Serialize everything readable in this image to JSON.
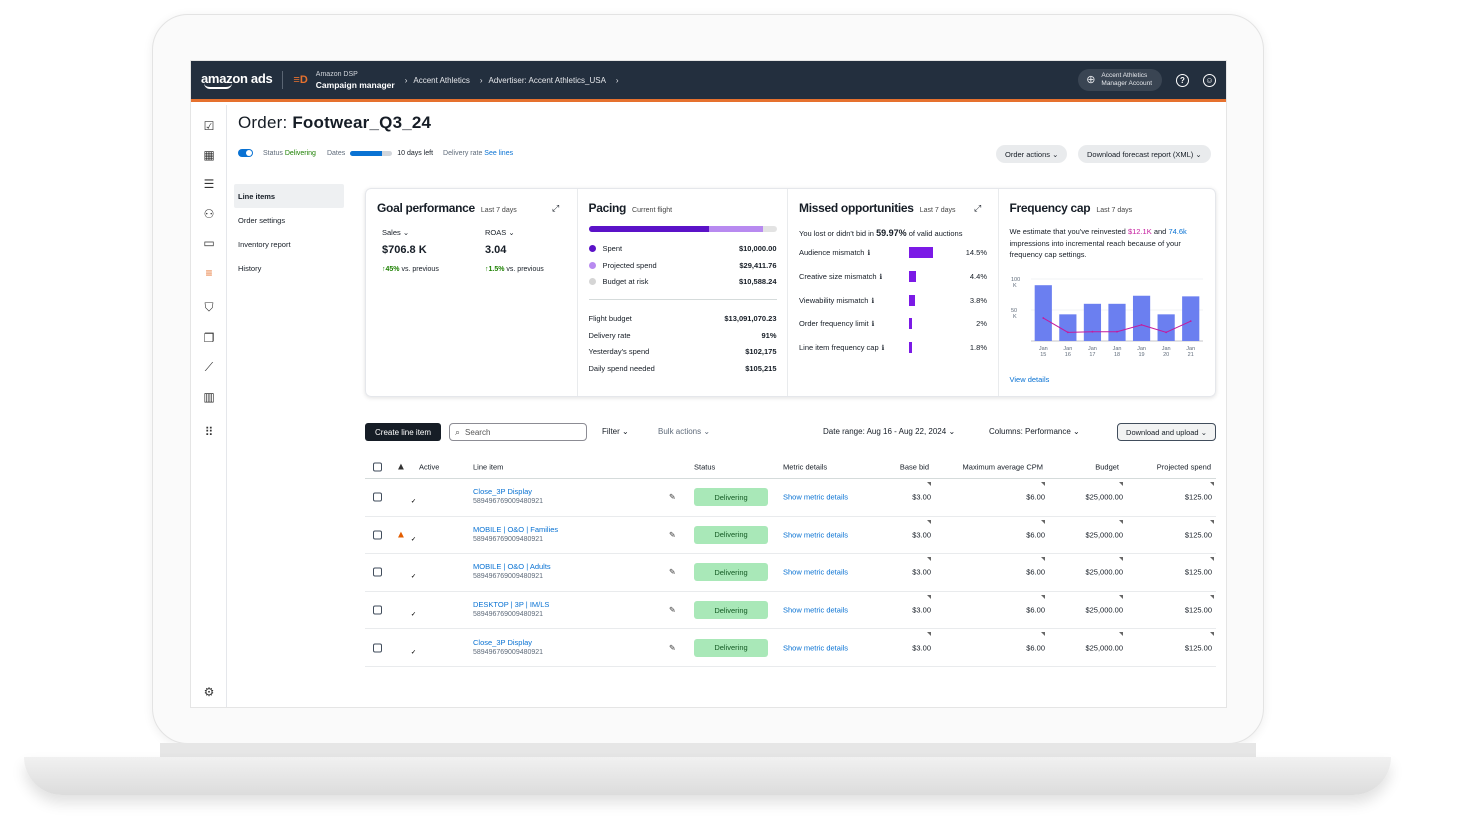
{
  "app": {
    "logo": "amazon ads",
    "product_icon": "≡D",
    "product_sub": "Amazon DSP",
    "product_name": "Campaign manager",
    "breadcrumb": [
      "Accent Athletics",
      "Advertiser: Accent Athletics_USA"
    ],
    "account_name": "Accent Athletics",
    "account_type": "Manager Account",
    "accent_color": "#e6712e"
  },
  "page": {
    "title_prefix": "Order:",
    "title": "Footwear_Q3_24",
    "status_label": "Status",
    "status_value": "Delivering",
    "dates_label": "Dates",
    "dates_progress": 0.75,
    "days_left": "10 days left",
    "delivery_rate_label": "Delivery rate",
    "delivery_rate_link": "See lines",
    "order_actions": "Order actions",
    "download_forecast": "Download forecast report (XML)"
  },
  "subnav": [
    "Line items",
    "Order settings",
    "Inventory report",
    "History"
  ],
  "goal": {
    "title": "Goal performance",
    "period": "Last 7 days",
    "metric1_label": "Sales",
    "metric1_value": "$706.8 K",
    "metric1_change": "45%",
    "metric1_change_note": "vs. previous",
    "metric2_label": "ROAS",
    "metric2_value": "3.04",
    "metric2_change": "1.5%",
    "metric2_change_note": "vs. previous"
  },
  "pacing": {
    "title": "Pacing",
    "period": "Current flight",
    "spent_fraction": 0.64,
    "projected_fraction": 0.93,
    "legend": [
      {
        "label": "Spent",
        "value": "$10,000.00",
        "color": "#5b12c8"
      },
      {
        "label": "Projected spend",
        "value": "$29,411.76",
        "color": "#b88af0"
      },
      {
        "label": "Budget at risk",
        "value": "$10,588.24",
        "color": "#d5d5d5"
      }
    ],
    "stats": [
      {
        "label": "Flight budget",
        "value": "$13,091,070.23"
      },
      {
        "label": "Delivery rate",
        "value": "91%"
      },
      {
        "label": "Yesterday's spend",
        "value": "$102,175"
      },
      {
        "label": "Daily spend needed",
        "value": "$105,215"
      }
    ]
  },
  "missed": {
    "title": "Missed opportunities",
    "period": "Last 7 days",
    "intro_before": "You lost or didn't bid in",
    "intro_pct": "59.97%",
    "intro_after": "of valid auctions",
    "rows": [
      {
        "label": "Audience mismatch",
        "value": "14.5%",
        "pct": 14.5
      },
      {
        "label": "Creative size mismatch",
        "value": "4.4%",
        "pct": 4.4
      },
      {
        "label": "Viewability mismatch",
        "value": "3.8%",
        "pct": 3.8
      },
      {
        "label": "Order frequency limit",
        "value": "2%",
        "pct": 2
      },
      {
        "label": "Line item frequency cap",
        "value": "1.8%",
        "pct": 1.8
      }
    ]
  },
  "freq": {
    "title": "Frequency cap",
    "period": "Last 7 days",
    "text_a": "We estimate that you've reinvested",
    "amount": "$12.1K",
    "text_b": "and",
    "impressions": "74.6k",
    "text_c": "impressions into incremental reach because of your frequency cap settings.",
    "view_details": "View details"
  },
  "chart_data": {
    "type": "bar",
    "categories": [
      "Jan 15",
      "Jan 16",
      "Jan 17",
      "Jan 18",
      "Jan 19",
      "Jan 20",
      "Jan 21"
    ],
    "series": [
      {
        "values": [
          90,
          43,
          60,
          60,
          73,
          43,
          72
        ],
        "color": "#6b7ff0"
      },
      {
        "values": [
          37,
          14,
          15,
          15,
          26,
          14,
          32
        ],
        "color": "#c41a9d"
      }
    ],
    "y_ticks": [
      [
        "100",
        "K"
      ],
      [
        "50",
        "K"
      ]
    ],
    "x_ticks": [
      [
        "Jan",
        "15"
      ],
      [
        "Jan",
        "16"
      ],
      [
        "Jan",
        "17"
      ],
      [
        "Jan",
        "18"
      ],
      [
        "Jan",
        "19"
      ],
      [
        "Jan",
        "20"
      ],
      [
        "Jan",
        "21"
      ]
    ],
    "ylim": [
      0,
      100
    ]
  },
  "toolbar": {
    "create": "Create line item",
    "search_placeholder": "Search",
    "filter": "Filter",
    "bulk": "Bulk actions",
    "date_range": "Date range: Aug 16 - Aug 22, 2024",
    "columns": "Columns: Performance",
    "download": "Download and upload"
  },
  "table": {
    "headers": {
      "active": "Active",
      "line_item": "Line item",
      "status": "Status",
      "metric": "Metric details",
      "base_bid": "Base bid",
      "max_cpm": "Maximum average CPM",
      "budget": "Budget",
      "projected": "Projected spend"
    },
    "rows": [
      {
        "name": "Close_3P Display",
        "id": "589496769009480921",
        "warn": false,
        "status": "Delivering",
        "metric": "Show metric details",
        "base_bid": "$3.00",
        "max_cpm": "$6.00",
        "budget": "$25,000.00",
        "projected": "$125.00"
      },
      {
        "name": "MOBILE | O&O | Families",
        "id": "589496769009480921",
        "warn": true,
        "status": "Delivering",
        "metric": "Show metric details",
        "base_bid": "$3.00",
        "max_cpm": "$6.00",
        "budget": "$25,000.00",
        "projected": "$125.00"
      },
      {
        "name": "MOBILE | O&O | Adults",
        "id": "589496769009480921",
        "warn": false,
        "status": "Delivering",
        "metric": "Show metric details",
        "base_bid": "$3.00",
        "max_cpm": "$6.00",
        "budget": "$25,000.00",
        "projected": "$125.00"
      },
      {
        "name": "DESKTOP | 3P | IM/LS",
        "id": "589496769009480921",
        "warn": false,
        "status": "Delivering",
        "metric": "Show metric details",
        "base_bid": "$3.00",
        "max_cpm": "$6.00",
        "budget": "$25,000.00",
        "projected": "$125.00"
      },
      {
        "name": "Close_3P Display",
        "id": "589496769009480921",
        "warn": false,
        "status": "Delivering",
        "metric": "Show metric details",
        "base_bid": "$3.00",
        "max_cpm": "$6.00",
        "budget": "$25,000.00",
        "projected": "$125.00"
      }
    ]
  },
  "rail_icons": [
    "checklist-icon",
    "dashboard-icon",
    "database-icon",
    "audience-icon",
    "creative-icon",
    "campaign-manager-icon",
    "brand-safety-icon",
    "media-icon",
    "trends-icon",
    "reports-icon",
    "apps-icon"
  ]
}
